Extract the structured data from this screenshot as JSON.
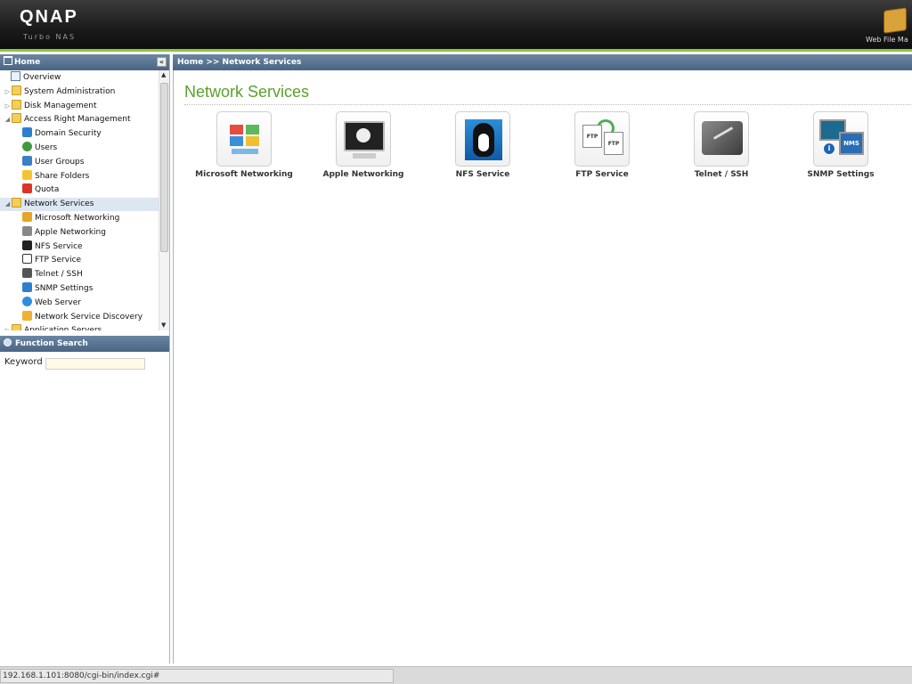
{
  "header": {
    "logo": "QNAP",
    "logo_sub": "Turbo NAS",
    "web_file_manager": "Web File Ma"
  },
  "sidebar": {
    "title": "Home",
    "items": [
      {
        "label": "Overview",
        "level": 1,
        "icon": "overview-icon",
        "arrow": ""
      },
      {
        "label": "System Administration",
        "level": 0,
        "icon": "folder-icon",
        "arrow": "▷"
      },
      {
        "label": "Disk Management",
        "level": 0,
        "icon": "folder-icon",
        "arrow": "▷"
      },
      {
        "label": "Access Right Management",
        "level": 0,
        "icon": "folder-icon",
        "arrow": "◢"
      },
      {
        "label": "Domain Security",
        "level": 2,
        "icon": "domain-security-icon",
        "arrow": ""
      },
      {
        "label": "Users",
        "level": 2,
        "icon": "user-icon",
        "arrow": ""
      },
      {
        "label": "User Groups",
        "level": 2,
        "icon": "user-groups-icon",
        "arrow": ""
      },
      {
        "label": "Share Folders",
        "level": 2,
        "icon": "share-folder-icon",
        "arrow": ""
      },
      {
        "label": "Quota",
        "level": 2,
        "icon": "quota-icon",
        "arrow": ""
      },
      {
        "label": "Network Services",
        "level": 0,
        "icon": "folder-icon",
        "arrow": "◢",
        "selected": true
      },
      {
        "label": "Microsoft Networking",
        "level": 2,
        "icon": "windows-icon",
        "arrow": ""
      },
      {
        "label": "Apple Networking",
        "level": 2,
        "icon": "apple-icon",
        "arrow": ""
      },
      {
        "label": "NFS Service",
        "level": 2,
        "icon": "penguin-icon",
        "arrow": ""
      },
      {
        "label": "FTP Service",
        "level": 2,
        "icon": "ftp-icon",
        "arrow": ""
      },
      {
        "label": "Telnet / SSH",
        "level": 2,
        "icon": "terminal-icon",
        "arrow": ""
      },
      {
        "label": "SNMP Settings",
        "level": 2,
        "icon": "snmp-icon",
        "arrow": ""
      },
      {
        "label": "Web Server",
        "level": 2,
        "icon": "globe-icon",
        "arrow": ""
      },
      {
        "label": "Network Service Discovery",
        "level": 2,
        "icon": "discovery-icon",
        "arrow": ""
      },
      {
        "label": "Application Servers",
        "level": 0,
        "icon": "folder-icon",
        "arrow": "▷"
      }
    ]
  },
  "function_search": {
    "title": "Function Search",
    "keyword_label": "Keyword :",
    "keyword_value": ""
  },
  "breadcrumb": "Home >> Network Services",
  "main": {
    "title": "Network Services",
    "services": [
      {
        "label": "Microsoft Networking",
        "icon": "windows-network-icon"
      },
      {
        "label": "Apple Networking",
        "icon": "apple-monitor-icon"
      },
      {
        "label": "NFS Service",
        "icon": "penguin-icon"
      },
      {
        "label": "FTP Service",
        "icon": "ftp-servers-icon"
      },
      {
        "label": "Telnet / SSH",
        "icon": "terminal-icon"
      },
      {
        "label": "SNMP Settings",
        "icon": "snmp-nms-icon"
      }
    ]
  },
  "statusbar": {
    "url": "192.168.1.101:8080/cgi-bin/index.cgi#"
  },
  "colors": {
    "accent_green": "#5aa02c",
    "header_dark": "#1a1a1a",
    "panel_blue": "#4a6583"
  }
}
